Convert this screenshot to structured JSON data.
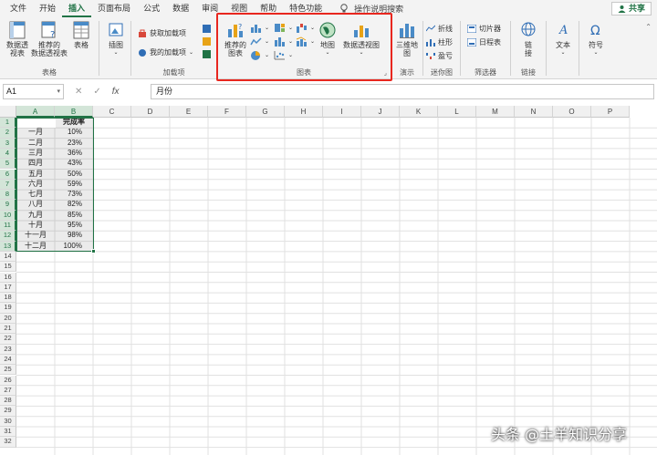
{
  "menu": {
    "tabs": [
      "文件",
      "开始",
      "插入",
      "页面布局",
      "公式",
      "数据",
      "审阅",
      "视图",
      "帮助",
      "特色功能"
    ],
    "active_tab": "插入",
    "tellme": "操作说明搜索",
    "share": "共享"
  },
  "ribbon": {
    "tables": {
      "label": "表格",
      "pivot": "数据透\n视表",
      "recommended_pivot": "推荐的\n数据透视表",
      "table": "表格"
    },
    "illustrations": {
      "label": "插图"
    },
    "addins": {
      "label": "加载项",
      "get": "获取加载项",
      "my": "我的加载项"
    },
    "charts": {
      "label": "图表",
      "recommended": "推荐的\n图表",
      "map": "地图",
      "pivot_chart": "数据透视图"
    },
    "tours": {
      "label": "演示",
      "3dmap": "三维地\n图"
    },
    "sparklines": {
      "label": "迷你图",
      "line": "折线",
      "column": "柱形",
      "winloss": "盈亏"
    },
    "filters": {
      "label": "筛选器",
      "slicer": "切片器",
      "timeline": "日程表"
    },
    "links": {
      "label": "链接",
      "link": "链\n接"
    },
    "text": {
      "label": "文本"
    },
    "symbols": {
      "label": "符号"
    }
  },
  "formula_bar": {
    "name_box": "A1",
    "cancel": "✕",
    "enter": "✓",
    "fx": "fx",
    "value": "月份"
  },
  "columns": [
    "A",
    "B",
    "C",
    "D",
    "E",
    "F",
    "G",
    "H",
    "I",
    "J",
    "K",
    "L",
    "M",
    "N",
    "O",
    "P"
  ],
  "rows": [
    "1",
    "2",
    "3",
    "4",
    "5",
    "6",
    "7",
    "8",
    "9",
    "10",
    "11",
    "12",
    "13",
    "14",
    "15",
    "16",
    "17",
    "18",
    "19",
    "20",
    "21",
    "22",
    "23",
    "24",
    "25",
    "26",
    "27",
    "28",
    "29",
    "30",
    "31",
    "32"
  ],
  "table": {
    "headers": [
      "月份",
      "完成率"
    ],
    "months": [
      "一月",
      "二月",
      "三月",
      "四月",
      "五月",
      "六月",
      "七月",
      "八月",
      "九月",
      "十月",
      "十一月",
      "十二月"
    ],
    "rates": [
      "10%",
      "23%",
      "36%",
      "43%",
      "50%",
      "59%",
      "73%",
      "82%",
      "85%",
      "95%",
      "98%",
      "100%"
    ]
  },
  "watermark": "头条 @土羊知识分享",
  "colors": {
    "accent": "#217346",
    "highlight": "#e8261e"
  }
}
